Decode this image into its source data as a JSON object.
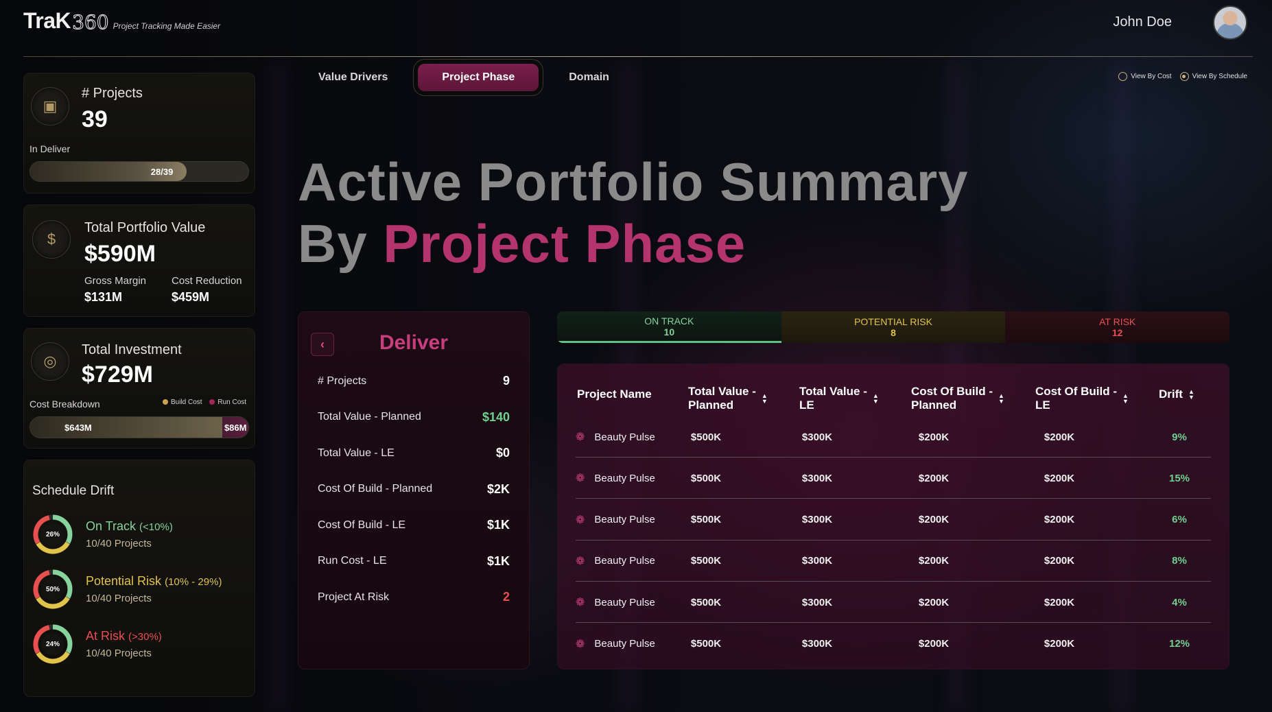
{
  "header": {
    "logo_main": "TraK",
    "logo_num": "360",
    "tagline": "Project Tracking Made Easier",
    "user_name": "John Doe"
  },
  "cards": {
    "projects": {
      "label": "# Projects",
      "value": "39",
      "sub_label": "In Deliver",
      "progress_text": "28/39",
      "progress_fraction": 0.718
    },
    "portfolio": {
      "label": "Total Portfolio Value",
      "value": "$590M",
      "gross_margin_label": "Gross Margin",
      "gross_margin_value": "$131M",
      "cost_reduction_label": "Cost Reduction",
      "cost_reduction_value": "$459M"
    },
    "investment": {
      "label": "Total Investment",
      "value": "$729M",
      "breakdown_label": "Cost Breakdown",
      "legend_build": "Build Cost",
      "legend_run": "Run Cost",
      "build_value": "$643M",
      "run_value": "$86M",
      "build_fraction": 0.882
    },
    "schedule_drift": {
      "title": "Schedule Drift",
      "items": [
        {
          "pct": "26%",
          "title": "On Track",
          "range": "(<10%)",
          "sub": "10/40 Projects",
          "color": "#86d39c"
        },
        {
          "pct": "50%",
          "title": "Potential Risk",
          "range": "(10% - 29%)",
          "sub": "10/40 Projects",
          "color": "#e2c34a"
        },
        {
          "pct": "24%",
          "title": "At Risk",
          "range": "(>30%)",
          "sub": "10/40 Projects",
          "color": "#e85050"
        }
      ]
    }
  },
  "tabs": [
    {
      "label": "Value Drivers",
      "active": false
    },
    {
      "label": "Project Phase",
      "active": true
    },
    {
      "label": "Domain",
      "active": false
    }
  ],
  "view_options": {
    "by_cost": "View By Cost",
    "by_schedule": "View By Schedule",
    "selected": "by_schedule"
  },
  "hero": {
    "line1": "Active Portfolio Summary",
    "line2_prefix": "By",
    "line2_accent": "Project Phase"
  },
  "deliver": {
    "title": "Deliver",
    "rows": [
      {
        "label": "# Projects",
        "value": "9",
        "color": "#ffffff"
      },
      {
        "label": "Total Value - Planned",
        "value": "$140",
        "color": "#6fd08f"
      },
      {
        "label": "Total Value - LE",
        "value": "$0",
        "color": "#ffffff"
      },
      {
        "label": "Cost Of Build - Planned",
        "value": "$2K",
        "color": "#ffffff"
      },
      {
        "label": "Cost Of Build - LE",
        "value": "$1K",
        "color": "#ffffff"
      },
      {
        "label": "Run Cost - LE",
        "value": "$1K",
        "color": "#ffffff"
      },
      {
        "label": "Project At Risk",
        "value": "2",
        "color": "#e85050"
      }
    ]
  },
  "status": {
    "on_track_label": "ON TRACK",
    "on_track_count": "10",
    "potential_risk_label": "POTENTIAL RISK",
    "potential_risk_count": "8",
    "at_risk_label": "AT RISK",
    "at_risk_count": "12"
  },
  "table": {
    "headers": {
      "name": "Project Name",
      "tv_planned_1": "Total Value -",
      "tv_planned_2": "Planned",
      "tv_le_1": "Total Value -",
      "tv_le_2": "LE",
      "cb_planned_1": "Cost Of Build -",
      "cb_planned_2": "Planned",
      "cb_le_1": "Cost Of Build -",
      "cb_le_2": "LE",
      "drift": "Drift"
    },
    "rows": [
      {
        "name": "Beauty Pulse",
        "tv_planned": "$500K",
        "tv_le": "$300K",
        "cb_planned": "$200K",
        "cb_le": "$200K",
        "drift": "9%"
      },
      {
        "name": "Beauty Pulse",
        "tv_planned": "$500K",
        "tv_le": "$300K",
        "cb_planned": "$200K",
        "cb_le": "$200K",
        "drift": "15%"
      },
      {
        "name": "Beauty Pulse",
        "tv_planned": "$500K",
        "tv_le": "$300K",
        "cb_planned": "$200K",
        "cb_le": "$200K",
        "drift": "6%"
      },
      {
        "name": "Beauty Pulse",
        "tv_planned": "$500K",
        "tv_le": "$300K",
        "cb_planned": "$200K",
        "cb_le": "$200K",
        "drift": "8%"
      },
      {
        "name": "Beauty Pulse",
        "tv_planned": "$500K",
        "tv_le": "$300K",
        "cb_planned": "$200K",
        "cb_le": "$200K",
        "drift": "4%"
      },
      {
        "name": "Beauty Pulse",
        "tv_planned": "$500K",
        "tv_le": "$300K",
        "cb_planned": "$200K",
        "cb_le": "$200K",
        "drift": "12%"
      }
    ]
  },
  "colors": {
    "accent": "#c83e7c",
    "on_track": "#86d39c",
    "potential_risk": "#e2c34a",
    "at_risk": "#e85050",
    "gold": "#c9b27c"
  }
}
